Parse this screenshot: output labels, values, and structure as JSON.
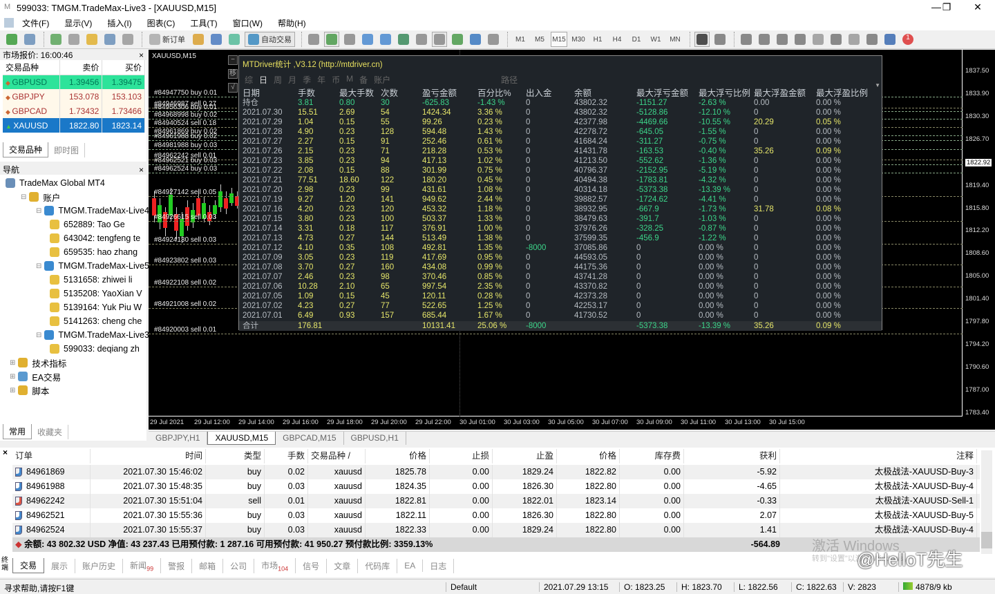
{
  "window": {
    "title": "599033: TMGM.TradeMax-Live3 - [XAUUSD,M15]",
    "minimize": "—",
    "restore": "❐",
    "close": "✕"
  },
  "menu": [
    "文件(F)",
    "显示(V)",
    "插入(I)",
    "图表(C)",
    "工具(T)",
    "窗口(W)",
    "帮助(H)"
  ],
  "toolbar": [
    {
      "icon": "new-chart-icon",
      "color": "#3a9b3a"
    },
    {
      "icon": "profiles-icon",
      "color": "#6a8fb8"
    },
    {
      "sep": true
    },
    {
      "icon": "market-watch-icon",
      "color": "#5aa55a"
    },
    {
      "icon": "data-window-icon",
      "color": "#999"
    },
    {
      "icon": "navigator-icon",
      "color": "#e0b030"
    },
    {
      "icon": "terminal-icon",
      "color": "#6a8fb8"
    },
    {
      "icon": "strategy-tester-icon",
      "color": "#999"
    },
    {
      "sep": true
    },
    {
      "icon": "new-order-icon",
      "color": "#aaa",
      "label": "新订单"
    },
    {
      "icon": "metaeditor-icon",
      "color": "#d9a030"
    },
    {
      "icon": "signals-icon",
      "color": "#4a7ac0"
    },
    {
      "icon": "options-icon",
      "color": "#5b9"
    },
    {
      "icon": "auto-trading-icon",
      "color": "#3a8ac0",
      "label": "自动交易",
      "boxed": true
    },
    {
      "sep": true
    },
    {
      "icon": "bar-chart-icon",
      "color": "#888"
    },
    {
      "icon": "candlestick-icon",
      "color": "#4a9a4a",
      "boxed": true
    },
    {
      "icon": "line-chart-icon",
      "color": "#888"
    },
    {
      "icon": "zoom-in-icon",
      "color": "#4a8ad0"
    },
    {
      "icon": "zoom-out-icon",
      "color": "#4a8ad0"
    },
    {
      "icon": "tile-windows-icon",
      "color": "#3a8a5a"
    },
    {
      "icon": "chart-shift-icon",
      "color": "#888"
    },
    {
      "icon": "autoscroll-icon",
      "color": "#888",
      "boxed": true
    },
    {
      "icon": "indicators-icon",
      "color": "#4a9a4a"
    },
    {
      "icon": "periods-icon",
      "color": "#3a78c0"
    },
    {
      "icon": "templates-icon",
      "color": "#888"
    },
    {
      "sep": true
    },
    {
      "tf": "M1"
    },
    {
      "tf": "M5"
    },
    {
      "tf": "M15",
      "on": true
    },
    {
      "tf": "M30"
    },
    {
      "tf": "H1"
    },
    {
      "tf": "H4"
    },
    {
      "tf": "D1"
    },
    {
      "tf": "W1"
    },
    {
      "tf": "MN"
    },
    {
      "sep": true
    },
    {
      "icon": "cursor-icon",
      "color": "#333",
      "boxed": true
    },
    {
      "icon": "crosshair-icon",
      "color": "#777"
    },
    {
      "sep": true
    },
    {
      "icon": "vertical-line-icon",
      "color": "#777"
    },
    {
      "icon": "horizontal-line-icon",
      "color": "#777"
    },
    {
      "icon": "trendline-icon",
      "color": "#777"
    },
    {
      "icon": "equidistant-channel-icon",
      "color": "#777"
    },
    {
      "icon": "fibonacci-icon",
      "color": "#999"
    },
    {
      "icon": "text-icon",
      "color": "#777"
    },
    {
      "icon": "text-label-icon",
      "color": "#999"
    },
    {
      "icon": "arrows-icon",
      "color": "#777"
    },
    {
      "icon": "search-icon",
      "color": "#3a6ab0"
    },
    {
      "icon": "notifications-icon",
      "color": "#d33",
      "badge": "1"
    }
  ],
  "market_watch": {
    "title": "市场报价: 16:00:46",
    "close": "×",
    "columns": [
      "交易品种",
      "卖价",
      "买价"
    ],
    "rows": [
      {
        "symbol": "GBPUSD",
        "bid": "1.39456",
        "ask": "1.39475",
        "bg": "#2de39a"
      },
      {
        "symbol": "GBPJPY",
        "bid": "153.078",
        "ask": "153.103",
        "bg": "#fff8ea"
      },
      {
        "symbol": "GBPCAD",
        "bid": "1.73432",
        "ask": "1.73466",
        "bg": "#fff8ea"
      },
      {
        "symbol": "XAUUSD",
        "bid": "1822.80",
        "ask": "1823.14",
        "bg": "#1a78c8"
      }
    ],
    "tabs": [
      "交易品种",
      "即时图"
    ]
  },
  "navigator": {
    "title": "导航",
    "close": "×",
    "items": [
      {
        "t": "TradeMax Global MT4",
        "lv": 0,
        "ic": "#6a8fb8"
      },
      {
        "t": "账户",
        "lv": 1,
        "ic": "#e0b030"
      },
      {
        "t": "TMGM.TradeMax-Live4",
        "lv": 2,
        "ic": "#3a8ad0"
      },
      {
        "t": "652889: Tao Ge",
        "lv": 3,
        "ic": "#e8c040"
      },
      {
        "t": "643042: tengfeng te",
        "lv": 3,
        "ic": "#e8c040"
      },
      {
        "t": "659535: hao zhang",
        "lv": 3,
        "ic": "#e8c040"
      },
      {
        "t": "TMGM.TradeMax-Live5",
        "lv": 2,
        "ic": "#3a8ad0"
      },
      {
        "t": "5131658: zhiwei li",
        "lv": 3,
        "ic": "#e8c040"
      },
      {
        "t": "5135208: YaoXian V",
        "lv": 3,
        "ic": "#e8c040"
      },
      {
        "t": "5139164: Yuk Piu W",
        "lv": 3,
        "ic": "#e8c040"
      },
      {
        "t": "5141263: cheng che",
        "lv": 3,
        "ic": "#e8c040"
      },
      {
        "t": "TMGM.TradeMax-Live3",
        "lv": 2,
        "ic": "#3a8ad0"
      },
      {
        "t": "599033: deqiang zh",
        "lv": 3,
        "ic": "#e8c040"
      },
      {
        "t": "技术指标",
        "lv": 0,
        "ic": "#e0b030"
      },
      {
        "t": "EA交易",
        "lv": 0,
        "ic": "#5a9ad0"
      },
      {
        "t": "脚本",
        "lv": 0,
        "ic": "#e0b030"
      }
    ],
    "tabs": [
      "常用",
      "收藏夹"
    ]
  },
  "chart": {
    "symbol_label": "XAUUSD,M15",
    "current_price": "1822.92",
    "price_ticks": [
      "1837.50",
      "1833.90",
      "1830.30",
      "1826.70",
      "1819.40",
      "1815.80",
      "1812.20",
      "1808.60",
      "1805.00",
      "1801.40",
      "1797.80",
      "1794.20",
      "1790.60",
      "1787.00",
      "1783.40"
    ],
    "price_range": [
      1783.4,
      1837.5
    ],
    "time_ticks": [
      "29 Jul 2021",
      "29 Jul 12:00",
      "29 Jul 14:00",
      "29 Jul 16:00",
      "29 Jul 18:00",
      "29 Jul 20:00",
      "29 Jul 22:00",
      "30 Jul 01:00",
      "30 Jul 03:00",
      "30 Jul 05:00",
      "30 Jul 07:00",
      "30 Jul 09:00",
      "30 Jul 11:00",
      "30 Jul 13:00",
      "30 Jul 15:00"
    ],
    "side_buttons": [
      "−",
      "移",
      "√"
    ],
    "orders": [
      {
        "label": "#84947750 buy 0.01",
        "price": 1833.46
      },
      {
        "label": "#84946987 sell 0.27",
        "price": 1831.71
      },
      {
        "label": "#84956306 buy 0.01",
        "price": 1831.16
      },
      {
        "label": "#84968998 buy 0.02",
        "price": 1829.96
      },
      {
        "label": "#84940524 sell 0.18",
        "price": 1828.65
      },
      {
        "label": "#84961869 buy 0.02",
        "price": 1827.33
      },
      {
        "label": "#84961988 buy 0.02",
        "price": 1826.57
      },
      {
        "label": "#84981988 buy 0.03",
        "price": 1825.15
      },
      {
        "label": "#84962242 sell 0.01",
        "price": 1823.51
      },
      {
        "label": "#84962521 buy 0.03",
        "price": 1822.74
      },
      {
        "label": "#84962524 buy 0.03",
        "price": 1821.43
      },
      {
        "label": "#84927142 sell 0.05",
        "price": 1817.72
      },
      {
        "label": "#84926615 sell 0.03",
        "price": 1813.78
      },
      {
        "label": "#84924130 sell 0.03",
        "price": 1810.18
      },
      {
        "label": "#84923802 sell 0.03",
        "price": 1806.9
      },
      {
        "label": "#84922108 sell 0.02",
        "price": 1803.4
      },
      {
        "label": "#84921008 sell 0.02",
        "price": 1800.01
      },
      {
        "label": "#84920003 sell 0.01",
        "price": 1795.97
      }
    ]
  },
  "stats": {
    "title": "MTDriver统计 ,V3.12 (http://mtdriver.cn)",
    "tabs": [
      "综",
      "日",
      "周",
      "月",
      "季",
      "年",
      "币",
      "M",
      "备",
      "账户",
      "路径"
    ],
    "active_tab": "日",
    "columns": [
      "日期",
      "手数",
      "最大手数",
      "次数",
      "盈亏金额",
      "百分比%",
      "出入金",
      "余额",
      "最大浮亏金额",
      "最大浮亏比例",
      "最大浮盈金额",
      "最大浮盈比例"
    ],
    "rows": [
      [
        "持仓",
        "3.81",
        "0.80",
        "30",
        "-625.83",
        "-1.43 %",
        "0",
        "43802.32",
        "-1151.27",
        "-2.63 %",
        "0.00",
        "0.00 %"
      ],
      [
        "2021.07.30",
        "15.51",
        "2.69",
        "54",
        "1424.34",
        "3.36 %",
        "0",
        "43802.32",
        "-5128.86",
        "-12.10 %",
        "0",
        "0.00 %"
      ],
      [
        "2021.07.29",
        "1.04",
        "0.15",
        "55",
        "99.26",
        "0.23 %",
        "0",
        "42377.98",
        "-4469.66",
        "-10.55 %",
        "20.29",
        "0.05 %"
      ],
      [
        "2021.07.28",
        "4.90",
        "0.23",
        "128",
        "594.48",
        "1.43 %",
        "0",
        "42278.72",
        "-645.05",
        "-1.55 %",
        "0",
        "0.00 %"
      ],
      [
        "2021.07.27",
        "2.27",
        "0.15",
        "91",
        "252.46",
        "0.61 %",
        "0",
        "41684.24",
        "-311.27",
        "-0.75 %",
        "0",
        "0.00 %"
      ],
      [
        "2021.07.26",
        "2.15",
        "0.23",
        "71",
        "218.28",
        "0.53 %",
        "0",
        "41431.78",
        "-163.53",
        "-0.40 %",
        "35.26",
        "0.09 %"
      ],
      [
        "2021.07.23",
        "3.85",
        "0.23",
        "94",
        "417.13",
        "1.02 %",
        "0",
        "41213.50",
        "-552.62",
        "-1.36 %",
        "0",
        "0.00 %"
      ],
      [
        "2021.07.22",
        "2.08",
        "0.15",
        "88",
        "301.99",
        "0.75 %",
        "0",
        "40796.37",
        "-2152.95",
        "-5.19 %",
        "0",
        "0.00 %"
      ],
      [
        "2021.07.21",
        "77.51",
        "18.60",
        "122",
        "180.20",
        "0.45 %",
        "0",
        "40494.38",
        "-1783.81",
        "-4.32 %",
        "0",
        "0.00 %"
      ],
      [
        "2021.07.20",
        "2.98",
        "0.23",
        "99",
        "431.61",
        "1.08 %",
        "0",
        "40314.18",
        "-5373.38",
        "-13.39 %",
        "0",
        "0.00 %"
      ],
      [
        "2021.07.19",
        "9.27",
        "1.20",
        "141",
        "949.62",
        "2.44 %",
        "0",
        "39882.57",
        "-1724.62",
        "-4.41 %",
        "0",
        "0.00 %"
      ],
      [
        "2021.07.16",
        "4.20",
        "0.23",
        "120",
        "453.32",
        "1.18 %",
        "0",
        "38932.95",
        "-667.9",
        "-1.73 %",
        "31.78",
        "0.08 %"
      ],
      [
        "2021.07.15",
        "3.80",
        "0.23",
        "100",
        "503.37",
        "1.33 %",
        "0",
        "38479.63",
        "-391.7",
        "-1.03 %",
        "0",
        "0.00 %"
      ],
      [
        "2021.07.14",
        "3.31",
        "0.18",
        "117",
        "376.91",
        "1.00 %",
        "0",
        "37976.26",
        "-328.25",
        "-0.87 %",
        "0",
        "0.00 %"
      ],
      [
        "2021.07.13",
        "4.73",
        "0.27",
        "144",
        "513.49",
        "1.38 %",
        "0",
        "37599.35",
        "-456.9",
        "-1.22 %",
        "0",
        "0.00 %"
      ],
      [
        "2021.07.12",
        "4.10",
        "0.35",
        "108",
        "492.81",
        "1.35 %",
        "-8000",
        "37085.86",
        "0",
        "0.00 %",
        "0",
        "0.00 %"
      ],
      [
        "2021.07.09",
        "3.05",
        "0.23",
        "119",
        "417.69",
        "0.95 %",
        "0",
        "44593.05",
        "0",
        "0.00 %",
        "0",
        "0.00 %"
      ],
      [
        "2021.07.08",
        "3.70",
        "0.27",
        "160",
        "434.08",
        "0.99 %",
        "0",
        "44175.36",
        "0",
        "0.00 %",
        "0",
        "0.00 %"
      ],
      [
        "2021.07.07",
        "2.46",
        "0.23",
        "98",
        "370.46",
        "0.85 %",
        "0",
        "43741.28",
        "0",
        "0.00 %",
        "0",
        "0.00 %"
      ],
      [
        "2021.07.06",
        "10.28",
        "2.10",
        "65",
        "997.54",
        "2.35 %",
        "0",
        "43370.82",
        "0",
        "0.00 %",
        "0",
        "0.00 %"
      ],
      [
        "2021.07.05",
        "1.09",
        "0.15",
        "45",
        "120.11",
        "0.28 %",
        "0",
        "42373.28",
        "0",
        "0.00 %",
        "0",
        "0.00 %"
      ],
      [
        "2021.07.02",
        "4.23",
        "0.27",
        "77",
        "522.65",
        "1.25 %",
        "0",
        "42253.17",
        "0",
        "0.00 %",
        "0",
        "0.00 %"
      ],
      [
        "2021.07.01",
        "6.49",
        "0.93",
        "157",
        "685.44",
        "1.67 %",
        "0",
        "41730.52",
        "0",
        "0.00 %",
        "0",
        "0.00 %"
      ]
    ],
    "total": [
      "合计",
      "176.81",
      "",
      "",
      "10131.41",
      "25.06 %",
      "-8000",
      "",
      "-5373.38",
      "-13.39 %",
      "35.26",
      "0.09 %"
    ]
  },
  "chart_tabs": [
    {
      "label": "GBPJPY,H1"
    },
    {
      "label": "XAUUSD,M15",
      "on": true
    },
    {
      "label": "GBPCAD,M15"
    },
    {
      "label": "GBPUSD,H1"
    }
  ],
  "terminal": {
    "close": "×",
    "side_label": "终端",
    "columns": [
      "订单",
      "时间",
      "类型",
      "手数",
      "交易品种  /",
      "价格",
      "止损",
      "止盈",
      "价格",
      "库存费",
      "获利",
      "注释"
    ],
    "rows": [
      {
        "type_dir": "buy",
        "cells": [
          "84961869",
          "2021.07.30 15:46:02",
          "buy",
          "0.02",
          "xauusd",
          "1825.78",
          "0.00",
          "1829.24",
          "1822.82",
          "0.00",
          "-5.92",
          "太极战法-XAUUSD-Buy-3"
        ]
      },
      {
        "type_dir": "buy",
        "cells": [
          "84961988",
          "2021.07.30 15:48:35",
          "buy",
          "0.03",
          "xauusd",
          "1824.35",
          "0.00",
          "1826.30",
          "1822.80",
          "0.00",
          "-4.65",
          "太极战法-XAUUSD-Buy-4"
        ]
      },
      {
        "type_dir": "sell",
        "cells": [
          "84962242",
          "2021.07.30 15:51:04",
          "sell",
          "0.01",
          "xauusd",
          "1822.81",
          "0.00",
          "1822.01",
          "1823.14",
          "0.00",
          "-0.33",
          "太极战法-XAUUSD-Sell-1"
        ]
      },
      {
        "type_dir": "buy",
        "cells": [
          "84962521",
          "2021.07.30 15:55:36",
          "buy",
          "0.03",
          "xauusd",
          "1822.11",
          "0.00",
          "1826.30",
          "1822.80",
          "0.00",
          "2.07",
          "太极战法-XAUUSD-Buy-5"
        ]
      },
      {
        "type_dir": "buy",
        "cells": [
          "84962524",
          "2021.07.30 15:55:37",
          "buy",
          "0.03",
          "xauusd",
          "1822.33",
          "0.00",
          "1829.24",
          "1822.80",
          "0.00",
          "1.41",
          "太极战法-XAUUSD-Buy-4"
        ]
      }
    ],
    "summary": "余额: 43 802.32 USD  净值: 43 237.43  已用预付款: 1 287.16  可用预付款: 41 950.27  预付款比例: 3359.13%",
    "summary_profit": "-564.89",
    "tabs": [
      {
        "l": "交易",
        "on": true
      },
      {
        "l": "展示"
      },
      {
        "l": "账户历史"
      },
      {
        "l": "新闻",
        "n": "99"
      },
      {
        "l": "警报"
      },
      {
        "l": "邮箱"
      },
      {
        "l": "公司"
      },
      {
        "l": "市场",
        "n": "104"
      },
      {
        "l": "信号"
      },
      {
        "l": "文章"
      },
      {
        "l": "代码库"
      },
      {
        "l": "EA"
      },
      {
        "l": "日志"
      }
    ]
  },
  "watermark": {
    "activate": "激活 Windows",
    "goto": "转到\"设置\"以激活 Windows。",
    "brand": "@HelloT先生"
  },
  "status": {
    "help": "寻求帮助,请按F1键",
    "profile": "Default",
    "time": "2021.07.29 13:15",
    "open": "O: 1823.25",
    "high": "H: 1823.70",
    "low": "L: 1822.56",
    "close": "C: 1822.63",
    "volume": "V: 2823",
    "traffic": "4878/9 kb"
  }
}
